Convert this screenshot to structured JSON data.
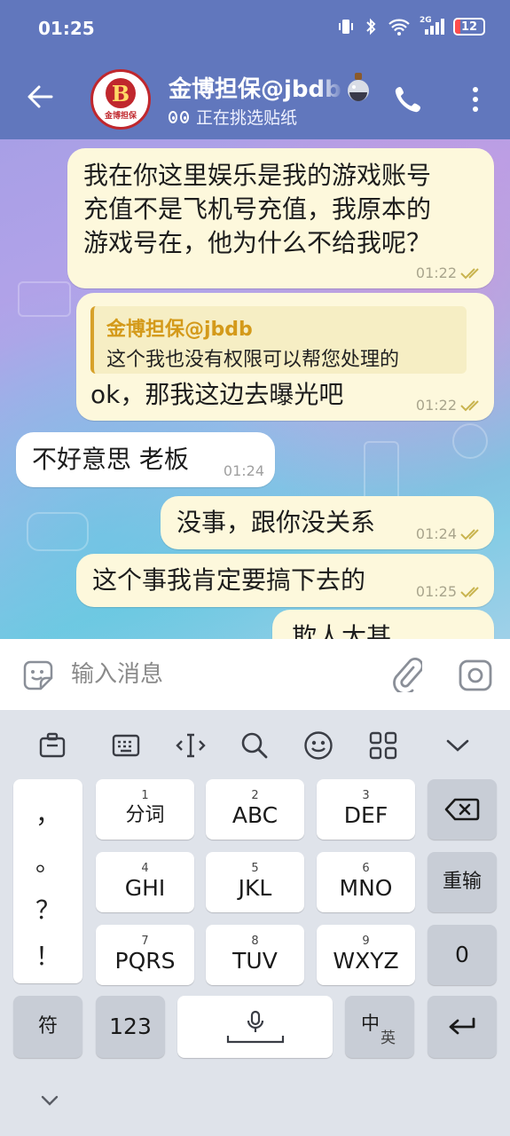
{
  "status_bar": {
    "time": "01:25",
    "battery": "12",
    "network": "2G"
  },
  "header": {
    "title": "金博担保@jbdb",
    "subtitle": "正在挑选贴纸",
    "avatar_text": "B",
    "avatar_caption": "金博担保"
  },
  "messages": [
    {
      "text_lines": [
        "我在你这里娱乐是我的游戏账号",
        "充值不是飞机号充值，我原本的",
        "游戏号在，他为什么不给我呢？"
      ],
      "time": "01:22",
      "direction": "out"
    },
    {
      "reply_to": {
        "name": "金博担保@jbdb",
        "text": "这个我也没有权限可以帮您处理的"
      },
      "text": "ok，那我这边去曝光吧",
      "time": "01:22",
      "direction": "out"
    },
    {
      "text": "不好意思 老板",
      "time": "01:24",
      "direction": "in"
    },
    {
      "text": "没事，跟你没关系",
      "time": "01:24",
      "direction": "out"
    },
    {
      "text": "这个事我肯定要搞下去的",
      "time": "01:25",
      "direction": "out"
    },
    {
      "text": "欺人太甚",
      "direction": "out"
    }
  ],
  "input": {
    "placeholder": "输入消息"
  },
  "keyboard": {
    "punctuation": [
      "，",
      "。",
      "？",
      "！"
    ],
    "rows": [
      [
        {
          "num": "1",
          "label": "分词"
        },
        {
          "num": "2",
          "label": "ABC"
        },
        {
          "num": "3",
          "label": "DEF"
        }
      ],
      [
        {
          "num": "4",
          "label": "GHI"
        },
        {
          "num": "5",
          "label": "JKL"
        },
        {
          "num": "6",
          "label": "MNO"
        }
      ],
      [
        {
          "num": "7",
          "label": "PQRS"
        },
        {
          "num": "8",
          "label": "TUV"
        },
        {
          "num": "9",
          "label": "WXYZ"
        }
      ]
    ],
    "reenter": "重输",
    "zero": "0",
    "symbols": "符",
    "numbers": "123",
    "lang_main": "中",
    "lang_alt": "英"
  },
  "colors": {
    "header": "#6177bd",
    "outgoing_bubble": "#fdf8dc",
    "incoming_bubble": "#ffffff",
    "quote_accent": "#d7a12a",
    "tick": "#c9b44f"
  }
}
